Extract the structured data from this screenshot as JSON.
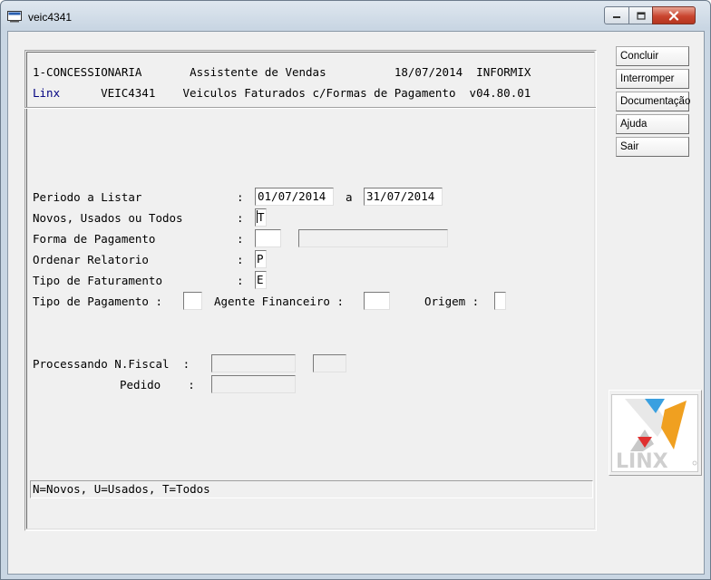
{
  "window": {
    "title": "veic4341"
  },
  "header": {
    "line1": "1-CONCESSIONARIA       Assistente de Vendas          18/07/2014  INFORMIX",
    "brand": "Linx",
    "line2": "      VEIC4341    Veiculos Faturados c/Formas de Pagamento  v04.80.01"
  },
  "form": {
    "periodo_label": "Periodo a Listar",
    "periodo_colon": ":",
    "periodo_from": "01/07/2014",
    "periodo_a": "a",
    "periodo_to": "31/07/2014",
    "novos_label": "Novos, Usados ou Todos",
    "novos_colon": ":",
    "novos_value": "T",
    "forma_label": "Forma de Pagamento",
    "forma_colon": ":",
    "forma_value": "",
    "forma_desc": "",
    "ordenar_label": "Ordenar Relatorio",
    "ordenar_colon": ":",
    "ordenar_value": "P",
    "tipo_fat_label": "Tipo de Faturamento",
    "tipo_fat_colon": ":",
    "tipo_fat_value": "E",
    "tipo_pag_label": "Tipo de Pagamento :",
    "tipo_pag_value": "",
    "agente_label": "Agente Financeiro :",
    "agente_value": "",
    "origem_label": "Origem :",
    "origem_value": "",
    "proc_label": "Processando N.Fiscal  :",
    "proc_value1": "",
    "proc_value2": "",
    "pedido_label": "Pedido    :",
    "pedido_value": ""
  },
  "status": {
    "hint": "N=Novos, U=Usados, T=Todos"
  },
  "sidebar": {
    "buttons": [
      "Concluir",
      "Interromper",
      "Documentação",
      "Ajuda",
      "Sair"
    ]
  },
  "logo": {
    "text": "LINX"
  },
  "colors": {
    "brand_blue": "#000080",
    "logo_orange": "#f0a020",
    "logo_red": "#e03030",
    "logo_blue": "#3aa0e0"
  }
}
